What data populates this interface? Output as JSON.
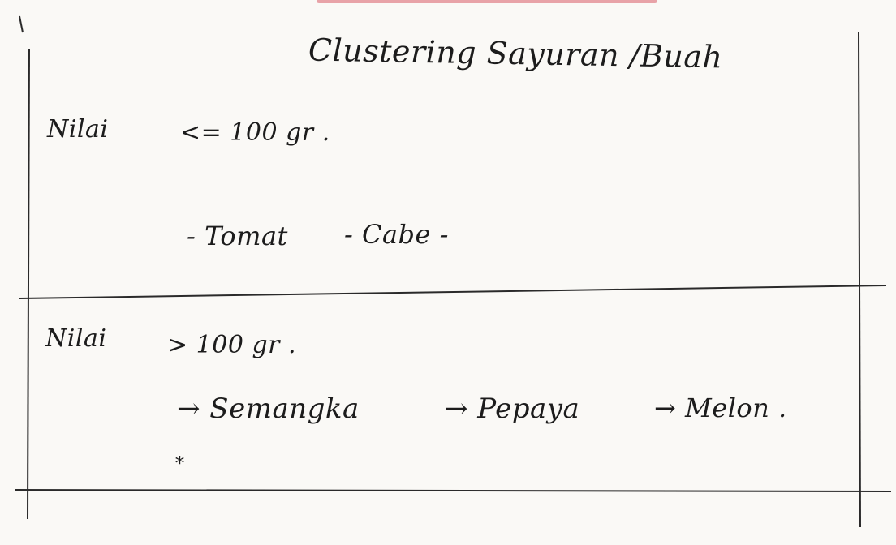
{
  "title": "Clustering Sayuran /Buah",
  "rows": [
    {
      "label": "Nilai",
      "rule": "<= 100 gr .",
      "items": [
        "- Tomat",
        "- Cabe -"
      ]
    },
    {
      "label": "Nilai",
      "rule": "> 100 gr .",
      "items": [
        "→ Semangka",
        "→ Pepaya",
        "→ Melon ."
      ]
    }
  ],
  "note_mark": "*"
}
